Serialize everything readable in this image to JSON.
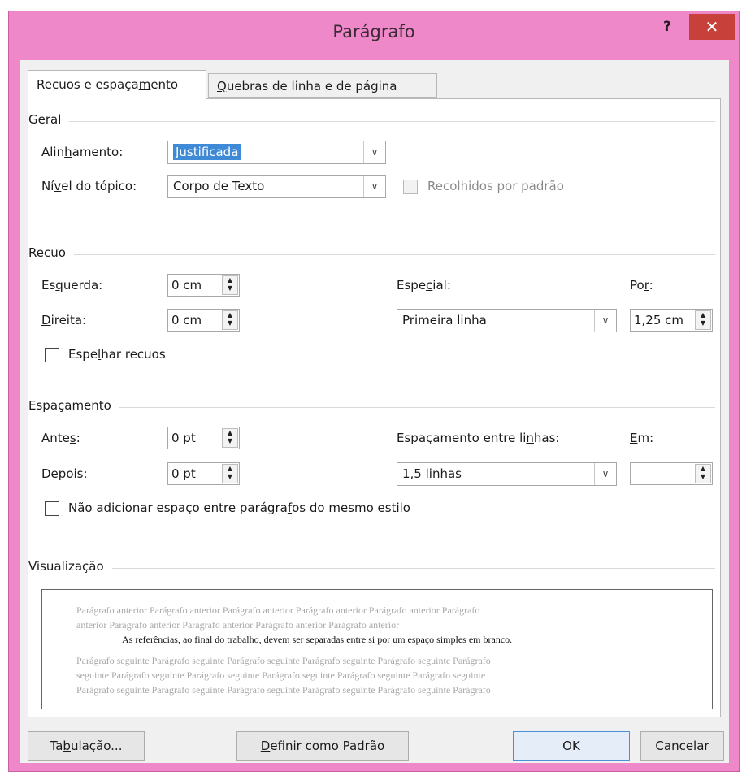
{
  "window": {
    "title": "Parágrafo",
    "help_label": "?",
    "close_label": "✕"
  },
  "tabs": [
    {
      "pre": "Recuos e espaça",
      "key": "m",
      "post": "ento"
    },
    {
      "pre": "",
      "key": "Q",
      "post": "uebras de linha e de página"
    }
  ],
  "geral": {
    "heading": "Geral",
    "alignment": {
      "pre": "Alin",
      "key": "h",
      "post": "amento:",
      "value": "Justificada"
    },
    "outline": {
      "pre": "Ní",
      "key": "v",
      "post": "el do tópico:",
      "value": "Corpo de Texto"
    },
    "collapsed_label": "Recolhidos por padrão"
  },
  "recuo": {
    "heading": "Recuo",
    "left": {
      "pre": "Es",
      "key": "q",
      "post": "uerda:",
      "value": "0 cm"
    },
    "right": {
      "pre": "",
      "key": "D",
      "post": "ireita:",
      "value": "0 cm"
    },
    "special": {
      "pre": "Espe",
      "key": "c",
      "post": "ial:",
      "value": "Primeira linha"
    },
    "by": {
      "pre": "Po",
      "key": "r",
      "post": ":",
      "value": "1,25 cm"
    },
    "mirror": {
      "pre": "Espe",
      "key": "l",
      "post": "har recuos"
    }
  },
  "espacamento": {
    "heading": "Espaçamento",
    "before": {
      "pre": "Ante",
      "key": "s",
      "post": ":",
      "value": "0 pt"
    },
    "after": {
      "pre": "Dep",
      "key": "o",
      "post": "is:",
      "value": "0 pt"
    },
    "line_spacing": {
      "pre": "Espaçamento entre li",
      "key": "n",
      "post": "has:",
      "value": "1,5 linhas"
    },
    "at": {
      "pre": "",
      "key": "E",
      "post": "m:",
      "value": ""
    },
    "no_space": {
      "pre": "Não adicionar espaço entre parágra",
      "key": "f",
      "post": "os do mesmo estilo"
    }
  },
  "visualizacao": {
    "heading": "Visualização",
    "prev_lines": [
      "Parágrafo anterior Parágrafo anterior Parágrafo anterior Parágrafo anterior Parágrafo anterior Parágrafo",
      "anterior Parágrafo anterior Parágrafo anterior Parágrafo anterior Parágrafo anterior"
    ],
    "current": "As referências, ao final do trabalho, devem ser separadas entre si por um espaço simples em branco.",
    "next_lines": [
      "Parágrafo seguinte Parágrafo seguinte Parágrafo seguinte Parágrafo seguinte Parágrafo seguinte Parágrafo",
      "seguinte Parágrafo seguinte Parágrafo seguinte Parágrafo seguinte Parágrafo seguinte Parágrafo seguinte",
      "Parágrafo seguinte Parágrafo seguinte Parágrafo seguinte Parágrafo seguinte Parágrafo seguinte Parágrafo"
    ]
  },
  "buttons": {
    "tabs": {
      "pre": "Ta",
      "key": "b",
      "post": "ulação..."
    },
    "default": {
      "pre": "",
      "key": "D",
      "post": "efinir como Padrão"
    },
    "ok": "OK",
    "cancel": "Cancelar"
  }
}
